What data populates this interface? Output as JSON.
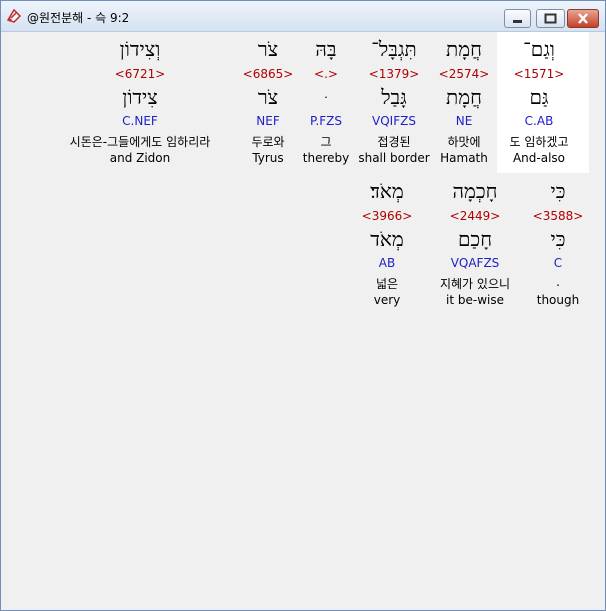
{
  "window": {
    "title": "@원전분해 - 슥 9:2",
    "controls": {
      "minimize": "minimize",
      "maximize": "maximize",
      "close": "close"
    }
  },
  "verse": {
    "rows": [
      {
        "words": [
          {
            "hebrew": "וְגַם־",
            "strong": "<1571>",
            "lemma": "גַּם",
            "morph": "C.AB",
            "korean": "도 임하겠고",
            "english": "And-also",
            "highlighted": true
          },
          {
            "hebrew": "חֲמָת",
            "strong": "<2574>",
            "lemma": "חֲמָת",
            "morph": "NE",
            "korean": "하맛에",
            "english": "Hamath"
          },
          {
            "hebrew": "תִּגְבָּל־",
            "strong": "<1379>",
            "lemma": "גָּבַל",
            "morph": "VQIFZS",
            "korean": "접경된",
            "english": "shall border"
          },
          {
            "hebrew": "בָּהּ",
            "strong": "<.>",
            "lemma": "ּ",
            "morph": "P.FZS",
            "korean": "그",
            "english": "thereby"
          },
          {
            "hebrew": "צֹר",
            "strong": "<6865>",
            "lemma": "צֹר",
            "morph": "NEF",
            "korean": "두로와",
            "english": "Tyrus"
          },
          {
            "hebrew": "וְצִידוֹן",
            "strong": "<6721>",
            "lemma": "צִידוֹן",
            "morph": "C.NEF",
            "korean": "시돈은-그들에게도 임하리라",
            "english": "and Zidon"
          }
        ]
      },
      {
        "words": [
          {
            "hebrew": "כִּי",
            "strong": "<3588>",
            "lemma": "כִּי",
            "morph": "C",
            "korean": ".",
            "english": "though"
          },
          {
            "hebrew": "חָכְמָה",
            "strong": "<2449>",
            "lemma": "חָכַם",
            "morph": "VQAFZS",
            "korean": "지혜가 있으니",
            "english": "it be-wise"
          },
          {
            "hebrew": "מְאֹד׃",
            "strong": "<3966>",
            "lemma": "מְאֹד",
            "morph": "AB",
            "korean": "넓은",
            "english": "very"
          }
        ]
      }
    ]
  }
}
